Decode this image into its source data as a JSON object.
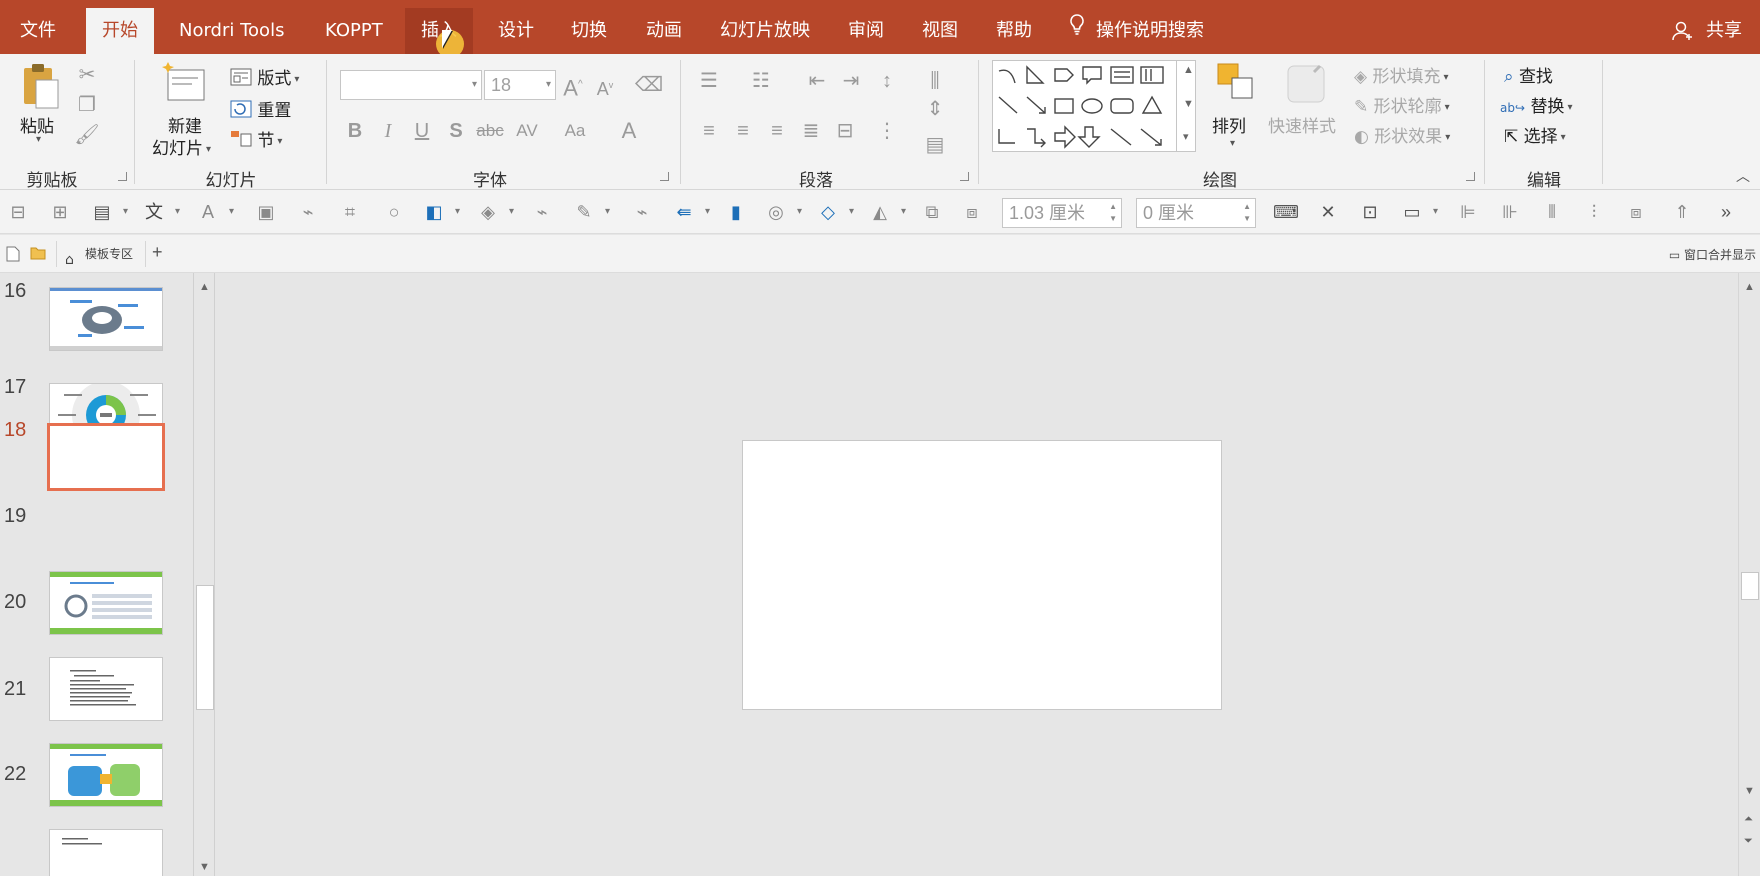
{
  "menubar": {
    "tabs": [
      "文件",
      "开始",
      "Nordri Tools",
      "KOPPT",
      "插入",
      "设计",
      "切换",
      "动画",
      "幻灯片放映",
      "审阅",
      "视图",
      "帮助"
    ],
    "active_tab": "开始",
    "hover_tab": "插入",
    "tell_me": "操作说明搜索",
    "share": "共享"
  },
  "ribbon": {
    "clipboard": {
      "label": "剪贴板",
      "paste": "粘贴"
    },
    "slides": {
      "label": "幻灯片",
      "new_slide_1": "新建",
      "new_slide_2": "幻灯片",
      "layout": "版式",
      "reset": "重置",
      "section": "节"
    },
    "font": {
      "label": "字体",
      "font_name": "",
      "font_size": "18"
    },
    "paragraph": {
      "label": "段落"
    },
    "drawing": {
      "label": "绘图",
      "arrange": "排列",
      "quick_styles": "快速样式",
      "shape_fill": "形状填充",
      "shape_outline": "形状轮廓",
      "shape_effects": "形状效果"
    },
    "editing": {
      "label": "编辑",
      "find": "查找",
      "replace": "替换",
      "select": "选择"
    }
  },
  "toolbar2": {
    "height_value": "1.03 厘米",
    "width_value": "0 厘米"
  },
  "docbar": {
    "template_tab": "模板专区",
    "merge_window": "窗口合并显示"
  },
  "slides": [
    {
      "num": "16",
      "selected": false
    },
    {
      "num": "17",
      "selected": false
    },
    {
      "num": "18",
      "selected": true
    },
    {
      "num": "19",
      "selected": false
    },
    {
      "num": "20",
      "selected": false
    },
    {
      "num": "21",
      "selected": false
    },
    {
      "num": "22",
      "selected": false
    }
  ],
  "colors": {
    "accent": "#b7472a",
    "selection": "#e66f4f",
    "cursor": "#f5c23b"
  }
}
